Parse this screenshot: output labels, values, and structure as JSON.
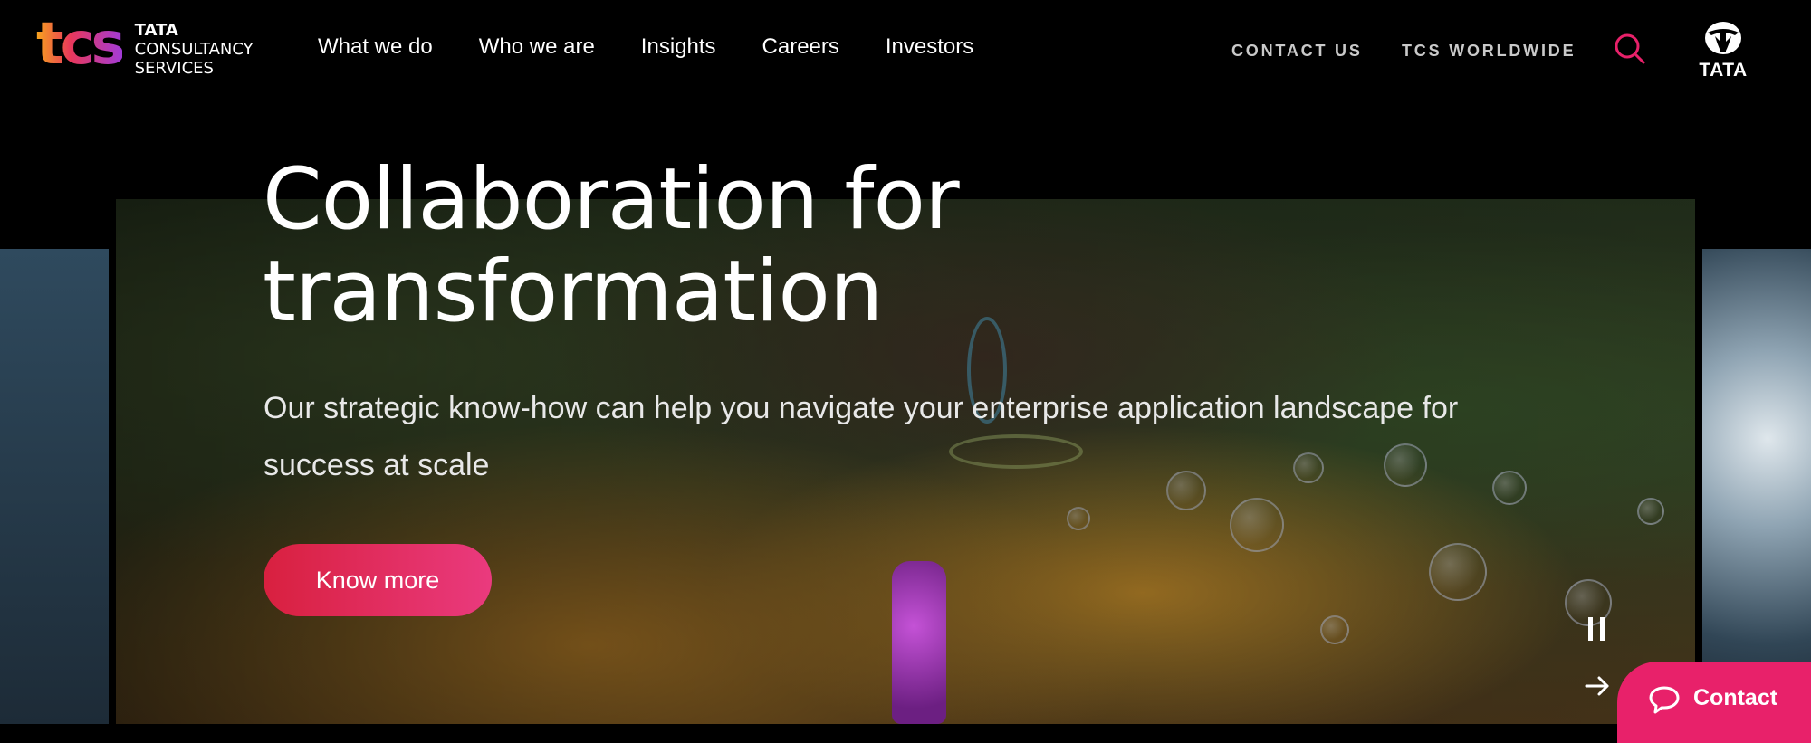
{
  "header": {
    "logo": {
      "mark": "tcs",
      "line1": "TATA",
      "line2": "CONSULTANCY",
      "line3": "SERVICES"
    },
    "nav": [
      "What we do",
      "Who we are",
      "Insights",
      "Careers",
      "Investors"
    ],
    "contact_us": "CONTACT US",
    "worldwide": "TCS WORLDWIDE",
    "search_icon": "search-icon",
    "tata_logo": {
      "word": "TATA"
    }
  },
  "hero": {
    "headline_line1": "Collaboration for",
    "headline_line2": "transformation",
    "subtext": "Our strategic know-how can help you navigate your enterprise application landscape for success at scale",
    "cta_label": "Know more",
    "pause_icon": "pause-icon",
    "next_icon": "arrow-right-icon"
  },
  "contact_fab": {
    "label": "Contact",
    "icon": "chat-bubble-icon"
  },
  "colors": {
    "accent": "#e8216a",
    "cta_start": "#d8203f",
    "cta_end": "#ea3a7e",
    "search": "#e8216a"
  }
}
